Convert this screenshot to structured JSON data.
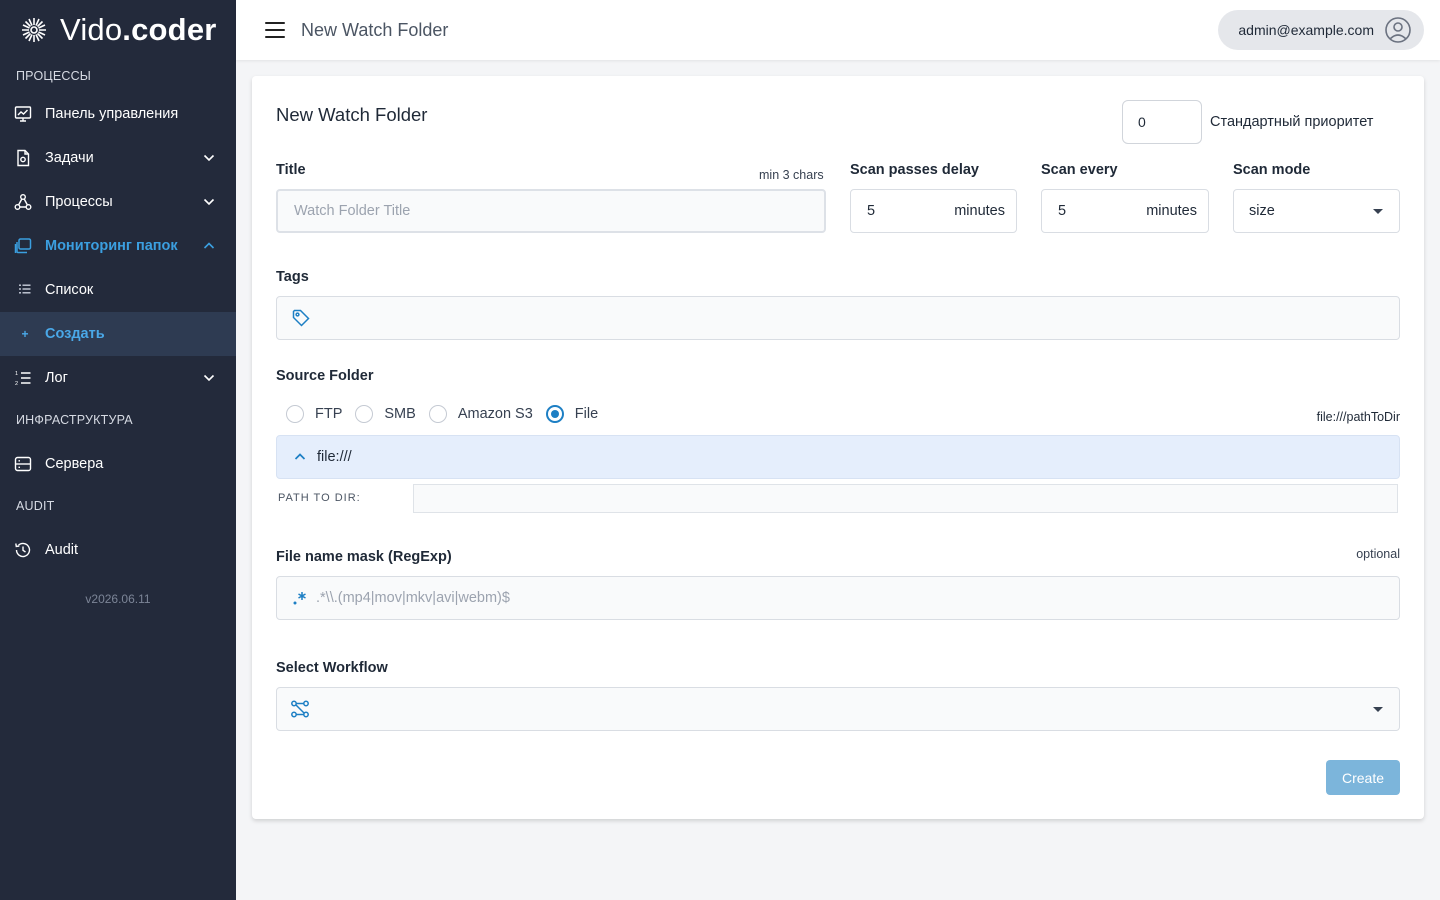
{
  "brand": {
    "name_light": "Vido",
    "name_bold": ".coder"
  },
  "sidebar": {
    "sections": [
      {
        "title": "ПРОЦЕССЫ"
      },
      {
        "title": "ИНФРАСТРУКТУРА"
      },
      {
        "title": "AUDIT"
      }
    ],
    "items": {
      "dashboard": "Панель управления",
      "tasks": "Задачи",
      "processes": "Процессы",
      "monitoring": "Мониторинг папок",
      "list": "Список",
      "create": "Создать",
      "log": "Лог",
      "servers": "Сервера",
      "audit": "Audit"
    },
    "version": "v2026.06.11"
  },
  "header": {
    "title": "New Watch Folder",
    "user": "admin@example.com"
  },
  "form": {
    "card_title": "New Watch Folder",
    "priority_value": "0",
    "priority_label": "Стандартный приоритет",
    "title_label": "Title",
    "title_hint": "min 3 chars",
    "title_placeholder": "Watch Folder Title",
    "scan_delay_label": "Scan passes delay",
    "scan_delay_value": "5",
    "scan_delay_unit": "minutes",
    "scan_every_label": "Scan every",
    "scan_every_value": "5",
    "scan_every_unit": "minutes",
    "scan_mode_label": "Scan mode",
    "scan_mode_value": "size",
    "tags_label": "Tags",
    "source_label": "Source Folder",
    "source_options": [
      "FTP",
      "SMB",
      "Amazon S3",
      "File"
    ],
    "source_selected": "File",
    "source_hint": "file:///pathToDir",
    "file_prefix": "file:///",
    "path_label": "PATH TO DIR:",
    "mask_label": "File name mask (RegExp)",
    "mask_hint": "optional",
    "mask_placeholder": ".*\\\\.(mp4|mov|mkv|avi|webm)$",
    "workflow_label": "Select Workflow",
    "create_button": "Create"
  },
  "colors": {
    "sidebar_bg": "#232a3b",
    "accent": "#1d7fc4",
    "active_link": "#3b9fe0",
    "button_disabled": "#7cb5db"
  }
}
